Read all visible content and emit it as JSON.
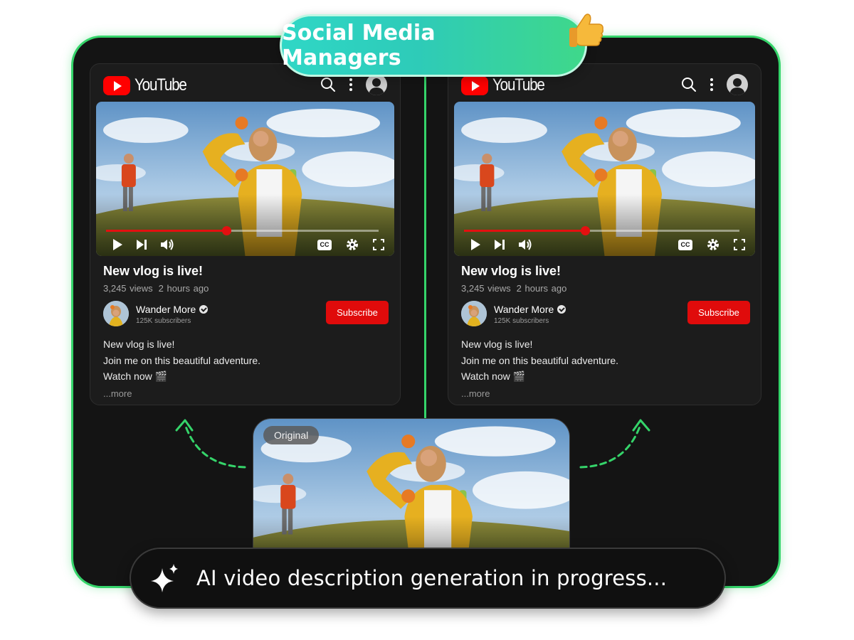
{
  "header": {
    "badge_label": "Social Media Managers",
    "badge_icon": "thumbs-up-icon"
  },
  "cards": [
    {
      "logo_text": "YouTube",
      "video_title": "New vlog is live!",
      "views": "3,245 views",
      "age": "2 hours ago",
      "channel_name": "Wander More",
      "subscribers": "125K subscribers",
      "subscribe_label": "Subscribe",
      "description_lines": [
        "New vlog is live!",
        "Join me on this beautiful adventure.",
        "Watch now 🎬"
      ],
      "more_label": "...more",
      "progress": 0.44,
      "cc_label": "CC"
    },
    {
      "logo_text": "YouTube",
      "video_title": "New vlog is live!",
      "views": "3,245 views",
      "age": "2 hours ago",
      "channel_name": "Wander More",
      "subscribers": "125K subscribers",
      "subscribe_label": "Subscribe",
      "description_lines": [
        "New vlog is live!",
        "Join me on this beautiful adventure.",
        "Watch now 🎬"
      ],
      "more_label": "...more",
      "progress": 0.44,
      "cc_label": "CC"
    }
  ],
  "original": {
    "badge_label": "Original"
  },
  "status_banner": {
    "text": "AI video description generation in progress...",
    "icon": "sparkle-icon"
  },
  "colors": {
    "accent_green": "#35d46a",
    "youtube_red": "#ff0000",
    "subscribe_red": "#e00b0b",
    "pill_teal": "#2fd7c6"
  }
}
